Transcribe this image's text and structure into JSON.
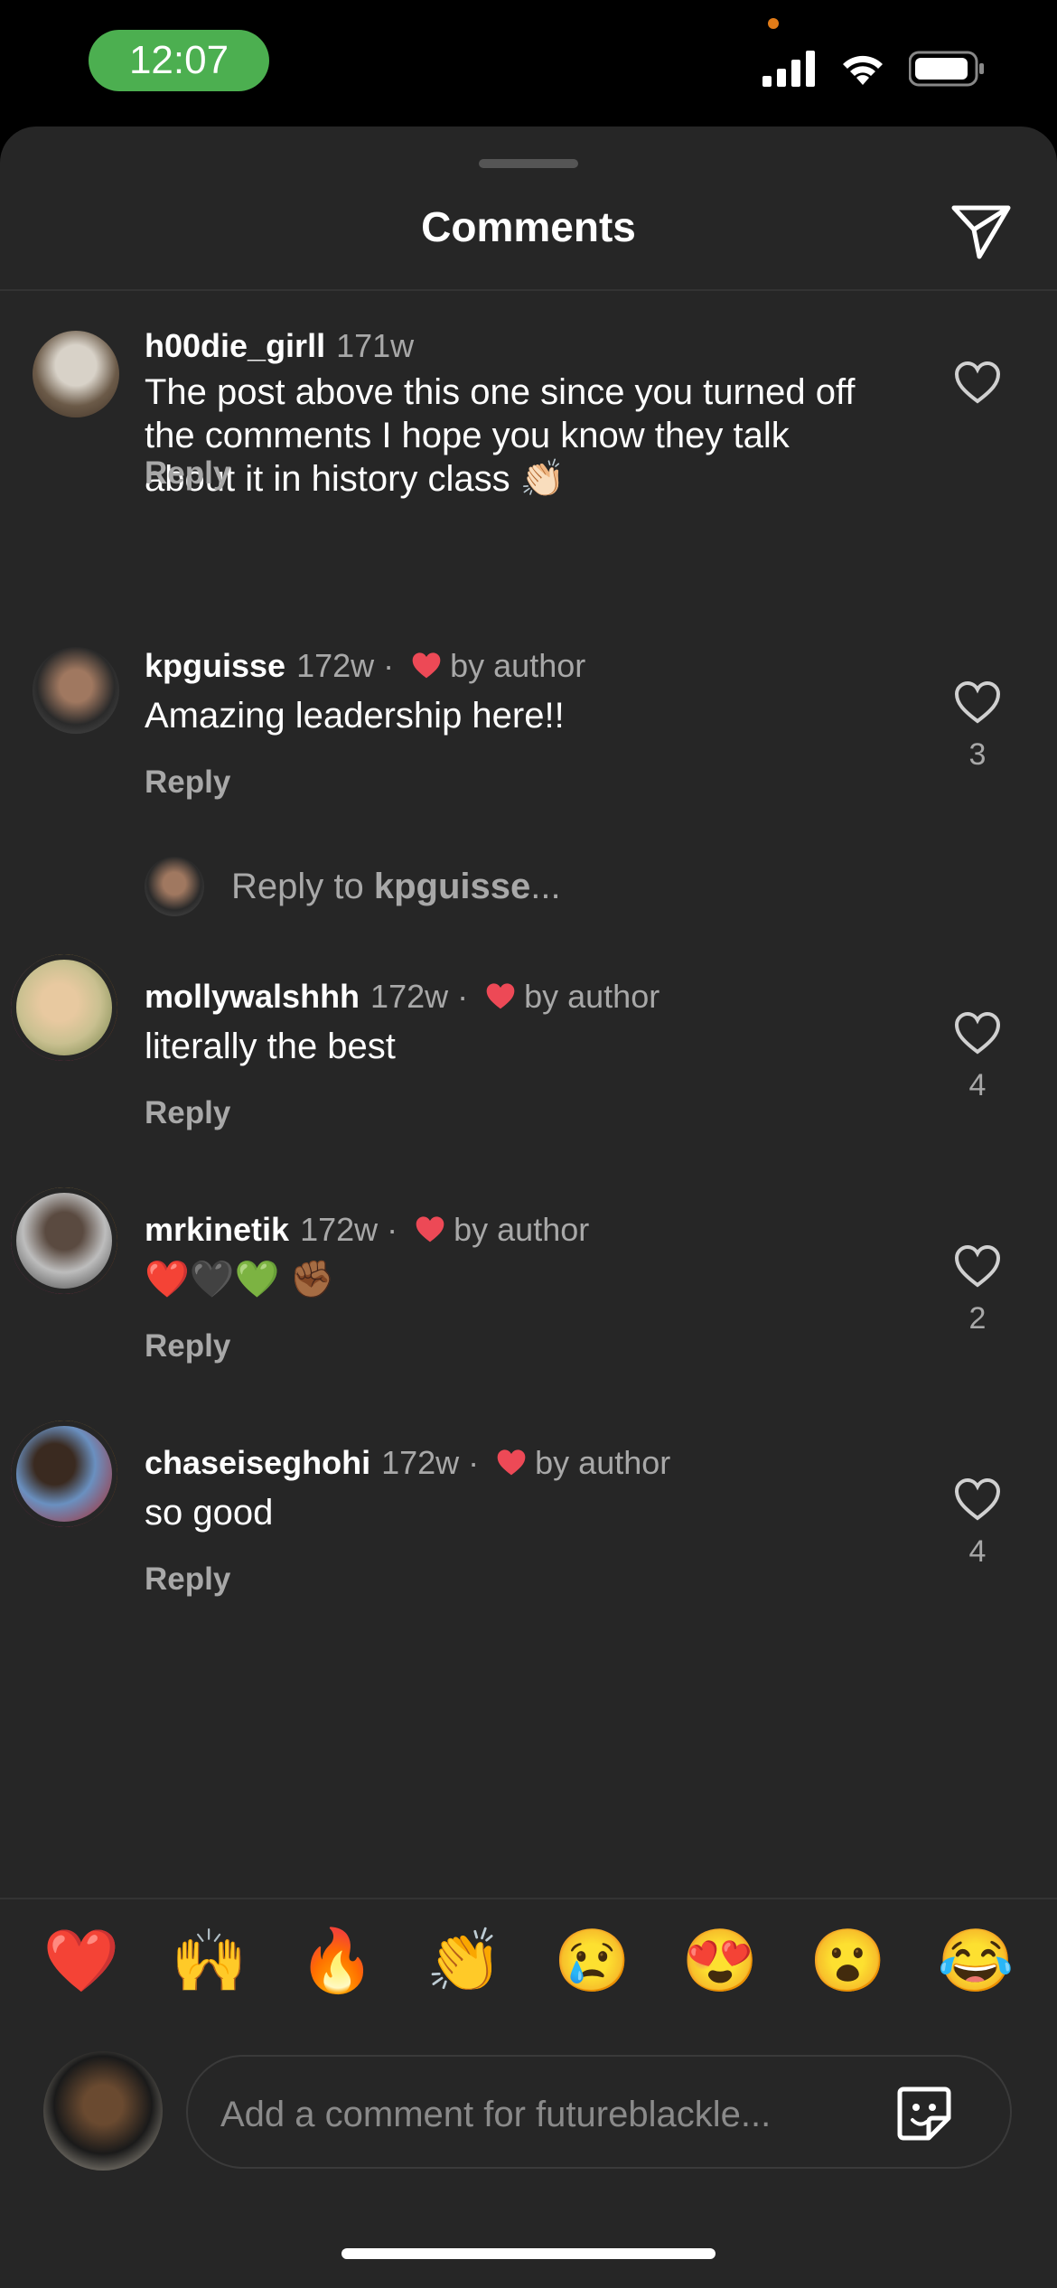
{
  "status_bar": {
    "time": "12:07",
    "time_pill_color": "#4CAF50"
  },
  "header": {
    "title": "Comments",
    "share_icon": "paper-plane-icon"
  },
  "comments": [
    {
      "username": "h00die_girll",
      "age": "171w",
      "liked_by_author": false,
      "text": "The post above this one since you turned off the comments I hope you know they talk about it in history class 👏🏻",
      "reply_label": "Reply",
      "likes": ""
    },
    {
      "username": "kpguisse",
      "age": "172w",
      "liked_by_author": true,
      "author_label": "by author",
      "text": "Amazing leadership here!!",
      "reply_label": "Reply",
      "likes": "3"
    },
    {
      "username": "mollywalshhh",
      "age": "172w",
      "liked_by_author": true,
      "author_label": "by author",
      "text": "literally the best",
      "reply_label": "Reply",
      "likes": "4"
    },
    {
      "username": "mrkinetik",
      "age": "172w",
      "liked_by_author": true,
      "author_label": "by author",
      "text": "❤️🖤💚 ✊🏾",
      "reply_label": "Reply",
      "likes": "2"
    },
    {
      "username": "chaseiseghohi",
      "age": "172w",
      "liked_by_author": true,
      "author_label": "by author",
      "text": "so good",
      "reply_label": "Reply",
      "likes": "4"
    }
  ],
  "reply_to": {
    "prefix": "Reply to ",
    "username": "kpguisse",
    "suffix": "..."
  },
  "emoji_bar": [
    "❤️",
    "🙌",
    "🔥",
    "👏",
    "😢",
    "😍",
    "😮",
    "😂"
  ],
  "composer": {
    "placeholder": "Add a comment for futureblackle..."
  },
  "colors": {
    "background": "#262626",
    "author_heart": "#ED4956",
    "muted_text": "#a8a8a8"
  }
}
